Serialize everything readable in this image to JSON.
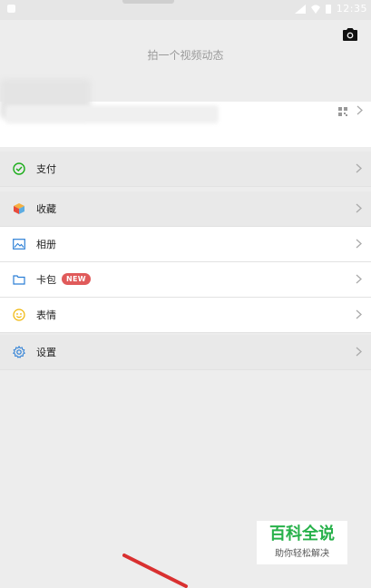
{
  "status_bar": {
    "time": "12:35"
  },
  "header": {
    "title": "拍一个视频动态",
    "camera_icon": "camera-icon"
  },
  "menu": {
    "pay": {
      "label": "支付",
      "icon": "wallet-icon",
      "color": "#1aad19"
    },
    "favorites": {
      "label": "收藏",
      "icon": "cube-icon",
      "color": "#f39c12"
    },
    "album": {
      "label": "相册",
      "icon": "image-icon",
      "color": "#2c7fd6"
    },
    "cards": {
      "label": "卡包",
      "icon": "folder-icon",
      "color": "#2c7fd6",
      "badge": "NEW"
    },
    "stickers": {
      "label": "表情",
      "icon": "smiley-icon",
      "color": "#f0b400"
    },
    "settings": {
      "label": "设置",
      "icon": "gear-icon",
      "color": "#2c7fd6"
    }
  },
  "watermark": {
    "title": "百科全说",
    "subtitle": "助你轻松解决"
  },
  "colors": {
    "badge": "#e05a5a",
    "watermark": "#27b14a",
    "arrow": "#d93030"
  }
}
